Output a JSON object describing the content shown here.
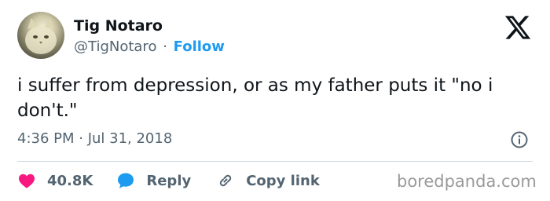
{
  "author": {
    "name": "Tig Notaro",
    "handle": "@TigNotaro",
    "separator": "·",
    "follow_label": "Follow",
    "avatar_icon": "cat-avatar"
  },
  "tweet": {
    "text": "i suffer from depression, or as my father puts it \"no i don't.\"",
    "timestamp": "4:36 PM · Jul 31, 2018"
  },
  "actions": {
    "likes_count": "40.8K",
    "reply_label": "Reply",
    "copy_link_label": "Copy link"
  },
  "icons": {
    "logo": "x-logo-icon",
    "info": "info-icon",
    "like": "heart-icon",
    "reply": "speech-bubble-icon",
    "copy": "link-icon"
  },
  "colors": {
    "accent": "#1d9bf0",
    "like": "#f91880",
    "secondary_text": "#536471"
  },
  "watermark": "boredpanda.com"
}
